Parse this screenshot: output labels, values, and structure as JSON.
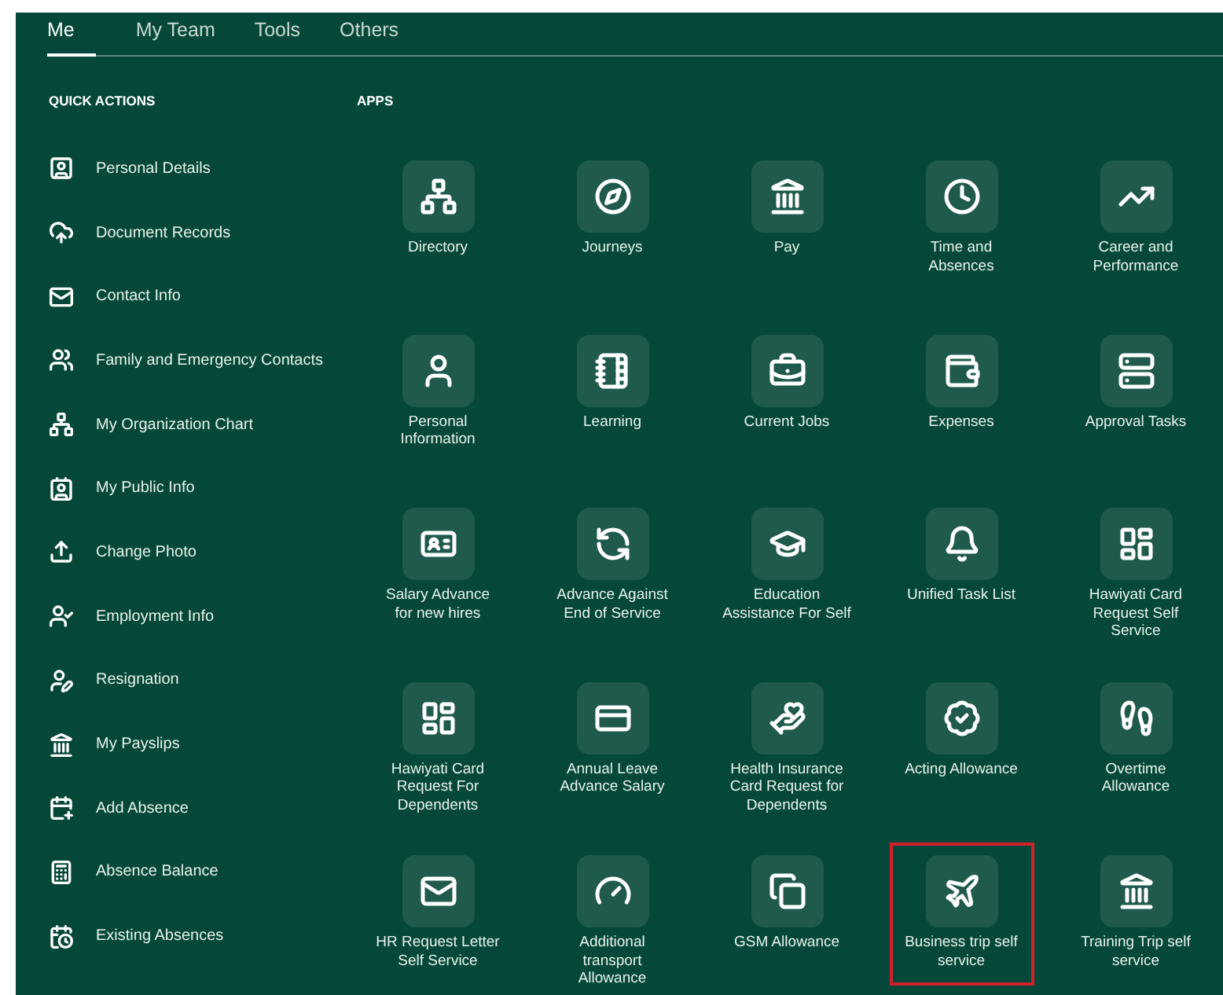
{
  "tabs": [
    {
      "label": "Me",
      "selected": true
    },
    {
      "label": "My Team",
      "selected": false
    },
    {
      "label": "Tools",
      "selected": false
    },
    {
      "label": "Others",
      "selected": false
    }
  ],
  "quick_actions": {
    "title": "QUICK ACTIONS",
    "items": [
      {
        "label": "Personal Details"
      },
      {
        "label": "Document Records"
      },
      {
        "label": "Contact Info"
      },
      {
        "label": "Family and Emergency Contacts"
      },
      {
        "label": "My Organization Chart"
      },
      {
        "label": "My Public Info"
      },
      {
        "label": "Change Photo"
      },
      {
        "label": "Employment Info"
      },
      {
        "label": "Resignation"
      },
      {
        "label": "My Payslips"
      },
      {
        "label": "Add Absence"
      },
      {
        "label": "Absence Balance"
      },
      {
        "label": "Existing Absences"
      }
    ]
  },
  "apps": {
    "title": "APPS",
    "items": [
      {
        "label": "Directory",
        "highlighted": false
      },
      {
        "label": "Journeys",
        "highlighted": false
      },
      {
        "label": "Pay",
        "highlighted": false
      },
      {
        "label": "Time and\nAbsences",
        "highlighted": false
      },
      {
        "label": "Career and\nPerformance",
        "highlighted": false
      },
      {
        "label": "Personal\nInformation",
        "highlighted": false
      },
      {
        "label": "Learning",
        "highlighted": false
      },
      {
        "label": "Current Jobs",
        "highlighted": false
      },
      {
        "label": "Expenses",
        "highlighted": false
      },
      {
        "label": "Approval Tasks",
        "highlighted": false
      },
      {
        "label": "Salary Advance\nfor new hires",
        "highlighted": false
      },
      {
        "label": "Advance Against\nEnd of Service",
        "highlighted": false
      },
      {
        "label": "Education\nAssistance For Self",
        "highlighted": false
      },
      {
        "label": "Unified Task List",
        "highlighted": false
      },
      {
        "label": "Hawiyati Card\nRequest Self\nService",
        "highlighted": false
      },
      {
        "label": "Hawiyati Card\nRequest For\nDependents",
        "highlighted": false
      },
      {
        "label": "Annual Leave\nAdvance Salary",
        "highlighted": false
      },
      {
        "label": "Health Insurance\nCard Request for\nDependents",
        "highlighted": false
      },
      {
        "label": "Acting Allowance",
        "highlighted": false
      },
      {
        "label": "Overtime\nAllowance",
        "highlighted": false
      },
      {
        "label": "HR Request Letter\nSelf Service",
        "highlighted": false
      },
      {
        "label": "Additional\ntransport\nAllowance",
        "highlighted": false
      },
      {
        "label": "GSM Allowance",
        "highlighted": false
      },
      {
        "label": "Business trip self\nservice",
        "highlighted": true
      },
      {
        "label": "Training Trip self\nservice",
        "highlighted": false
      }
    ]
  }
}
